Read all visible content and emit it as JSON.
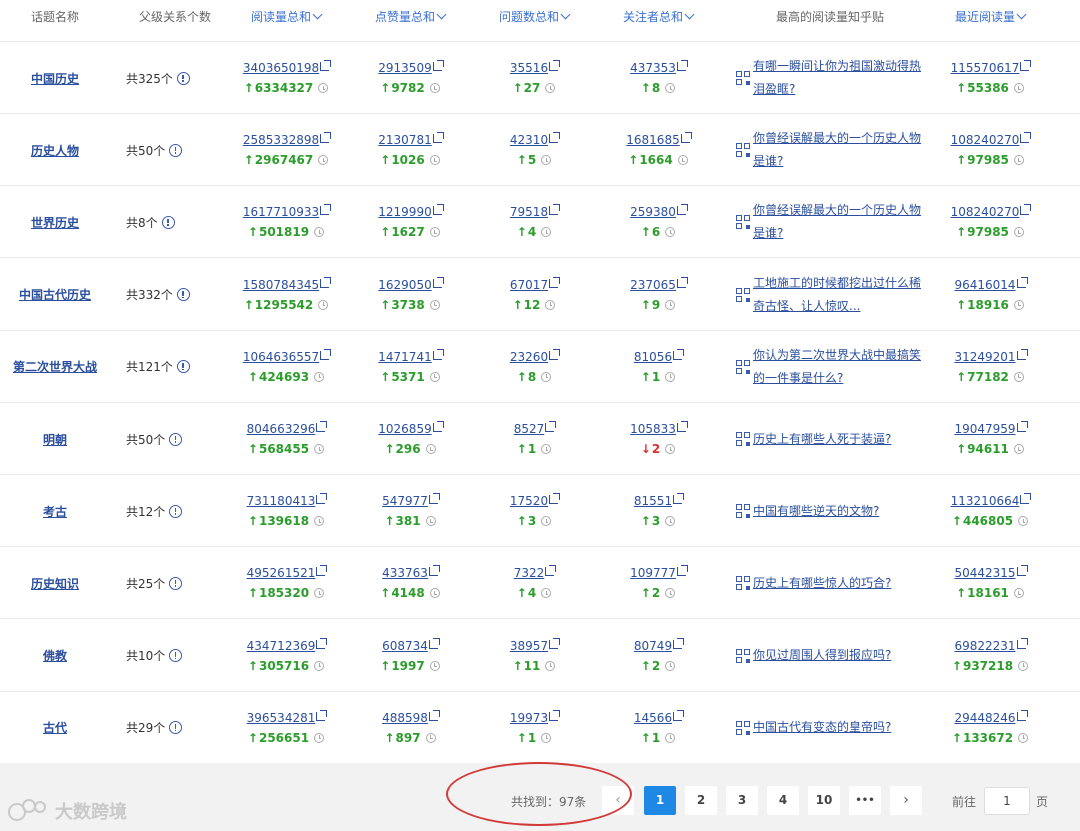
{
  "columns": {
    "topic": "话题名称",
    "parents": "父级关系个数",
    "reads": "阅读量总和",
    "likes": "点赞量总和",
    "questions": "问题数总和",
    "followers": "关注者总和",
    "top_post": "最高的阅读量知乎贴",
    "recent": "最近阅读量"
  },
  "rows": [
    {
      "topic": "中国历史",
      "parents": "共325个",
      "reads": "3403650198",
      "reads_delta": "6334327",
      "reads_dir": "↑",
      "likes": "2913509",
      "likes_delta": "9782",
      "likes_dir": "↑",
      "questions": "35516",
      "questions_delta": "27",
      "questions_dir": "↑",
      "followers": "437353",
      "followers_delta": "8",
      "followers_dir": "↑",
      "post": "有哪一瞬间让你为祖国激动得热泪盈眶?",
      "recent": "115570617",
      "recent_delta": "55386",
      "recent_dir": "↑"
    },
    {
      "topic": "历史人物",
      "parents": "共50个",
      "reads": "2585332898",
      "reads_delta": "2967467",
      "reads_dir": "↑",
      "likes": "2130781",
      "likes_delta": "1026",
      "likes_dir": "↑",
      "questions": "42310",
      "questions_delta": "5",
      "questions_dir": "↑",
      "followers": "1681685",
      "followers_delta": "1664",
      "followers_dir": "↑",
      "post": "你曾经误解最大的一个历史人物是谁?",
      "recent": "108240270",
      "recent_delta": "97985",
      "recent_dir": "↑"
    },
    {
      "topic": "世界历史",
      "parents": "共8个",
      "reads": "1617710933",
      "reads_delta": "501819",
      "reads_dir": "↑",
      "likes": "1219990",
      "likes_delta": "1627",
      "likes_dir": "↑",
      "questions": "79518",
      "questions_delta": "4",
      "questions_dir": "↑",
      "followers": "259380",
      "followers_delta": "6",
      "followers_dir": "↑",
      "post": "你曾经误解最大的一个历史人物是谁?",
      "recent": "108240270",
      "recent_delta": "97985",
      "recent_dir": "↑"
    },
    {
      "topic": "中国古代历史",
      "parents": "共332个",
      "reads": "1580784345",
      "reads_delta": "1295542",
      "reads_dir": "↑",
      "likes": "1629050",
      "likes_delta": "3738",
      "likes_dir": "↑",
      "questions": "67017",
      "questions_delta": "12",
      "questions_dir": "↑",
      "followers": "237065",
      "followers_delta": "9",
      "followers_dir": "↑",
      "post": "工地施工的时候都挖出过什么稀奇古怪、让人惊叹...",
      "recent": "96416014",
      "recent_delta": "18916",
      "recent_dir": "↑"
    },
    {
      "topic": "第二次世界大战",
      "parents": "共121个",
      "reads": "1064636557",
      "reads_delta": "424693",
      "reads_dir": "↑",
      "likes": "1471741",
      "likes_delta": "5371",
      "likes_dir": "↑",
      "questions": "23260",
      "questions_delta": "8",
      "questions_dir": "↑",
      "followers": "81056",
      "followers_delta": "1",
      "followers_dir": "↑",
      "post": "你认为第二次世界大战中最搞笑的一件事是什么?",
      "recent": "31249201",
      "recent_delta": "77182",
      "recent_dir": "↑"
    },
    {
      "topic": "明朝",
      "parents": "共50个",
      "reads": "804663296",
      "reads_delta": "568455",
      "reads_dir": "↑",
      "likes": "1026859",
      "likes_delta": "296",
      "likes_dir": "↑",
      "questions": "8527",
      "questions_delta": "1",
      "questions_dir": "↑",
      "followers": "105833",
      "followers_delta": "2",
      "followers_dir": "↓",
      "post": "历史上有哪些人死于装逼?",
      "recent": "19047959",
      "recent_delta": "94611",
      "recent_dir": "↑"
    },
    {
      "topic": "考古",
      "parents": "共12个",
      "reads": "731180413",
      "reads_delta": "139618",
      "reads_dir": "↑",
      "likes": "547977",
      "likes_delta": "381",
      "likes_dir": "↑",
      "questions": "17520",
      "questions_delta": "3",
      "questions_dir": "↑",
      "followers": "81551",
      "followers_delta": "3",
      "followers_dir": "↑",
      "post": "中国有哪些逆天的文物?",
      "recent": "113210664",
      "recent_delta": "446805",
      "recent_dir": "↑"
    },
    {
      "topic": "历史知识",
      "parents": "共25个",
      "reads": "495261521",
      "reads_delta": "185320",
      "reads_dir": "↑",
      "likes": "433763",
      "likes_delta": "4148",
      "likes_dir": "↑",
      "questions": "7322",
      "questions_delta": "4",
      "questions_dir": "↑",
      "followers": "109777",
      "followers_delta": "2",
      "followers_dir": "↑",
      "post": "历史上有哪些惊人的巧合?",
      "recent": "50442315",
      "recent_delta": "18161",
      "recent_dir": "↑"
    },
    {
      "topic": "佛教",
      "parents": "共10个",
      "reads": "434712369",
      "reads_delta": "305716",
      "reads_dir": "↑",
      "likes": "608734",
      "likes_delta": "1997",
      "likes_dir": "↑",
      "questions": "38957",
      "questions_delta": "11",
      "questions_dir": "↑",
      "followers": "80749",
      "followers_delta": "2",
      "followers_dir": "↑",
      "post": "你见过周围人得到报应吗?",
      "recent": "69822231",
      "recent_delta": "937218",
      "recent_dir": "↑"
    },
    {
      "topic": "古代",
      "parents": "共29个",
      "reads": "396534281",
      "reads_delta": "256651",
      "reads_dir": "↑",
      "likes": "488598",
      "likes_delta": "897",
      "likes_dir": "↑",
      "questions": "19973",
      "questions_delta": "1",
      "questions_dir": "↑",
      "followers": "14566",
      "followers_delta": "1",
      "followers_dir": "↑",
      "post": "中国古代有变态的皇帝吗?",
      "recent": "29448246",
      "recent_delta": "133672",
      "recent_dir": "↑"
    }
  ],
  "pagination": {
    "total": "共找到：97条",
    "prev": "‹",
    "next": "›",
    "pages": [
      "1",
      "2",
      "3",
      "4",
      "10",
      "•••"
    ],
    "active": "1",
    "goto_label": "前往",
    "goto_value": "1",
    "goto_unit": "页"
  },
  "watermark": "大数跨境",
  "colors": {
    "link": "#2b4f9e",
    "header_sort": "#3a6fd0",
    "up": "#2a9d2a",
    "down": "#d9302a",
    "active_page": "#1e88e5",
    "annotation": "#d23a3a"
  }
}
